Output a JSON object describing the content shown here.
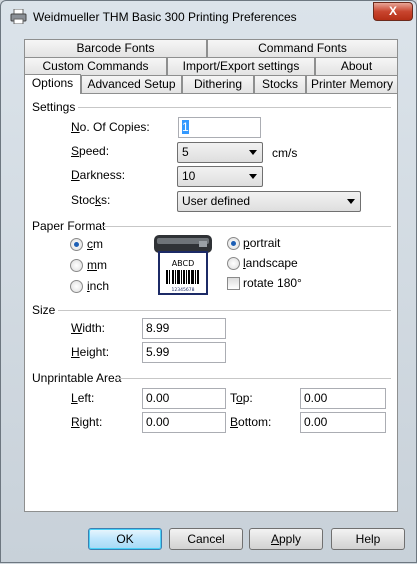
{
  "window": {
    "title": "Weidmueller THM Basic 300 Printing Preferences",
    "close_label": "X"
  },
  "tabs": {
    "row1": [
      "Barcode Fonts",
      "Command Fonts"
    ],
    "row2": [
      "Custom Commands",
      "Import/Export settings",
      "About"
    ],
    "row3": [
      "Options",
      "Advanced Setup",
      "Dithering",
      "Stocks",
      "Printer Memory"
    ],
    "active": "Options"
  },
  "settings": {
    "section": "Settings",
    "copies_label_u": "N",
    "copies_label_rest": "o. Of Copies:",
    "copies_value": "1",
    "speed_label_u": "S",
    "speed_label_rest": "peed:",
    "speed_value": "5",
    "speed_unit": "cm/s",
    "darkness_label_u": "D",
    "darkness_label_rest": "arkness:",
    "darkness_value": "10",
    "stocks_label_pre": "Stoc",
    "stocks_label_u": "k",
    "stocks_label_rest": "s:",
    "stocks_value": "User defined"
  },
  "paper_format": {
    "section": "Paper Format",
    "units": [
      {
        "u": "c",
        "rest": "m",
        "checked": true
      },
      {
        "u": "m",
        "rest": "m",
        "checked": false
      },
      {
        "u": "i",
        "rest": "nch",
        "checked": false
      }
    ],
    "orientation": [
      {
        "u": "p",
        "rest": "ortrait",
        "checked": true
      },
      {
        "u": "l",
        "rest": "andscape",
        "checked": false
      }
    ],
    "rotate_label": "rotate 180°",
    "rotate_checked": false,
    "label_preview_text": "ABCD",
    "label_preview_number": "12345678"
  },
  "size": {
    "section": "Size",
    "width_label_u": "W",
    "width_label_rest": "idth:",
    "width_value": "8.99",
    "height_label_u": "H",
    "height_label_rest": "eight:",
    "height_value": "5.99"
  },
  "unprintable": {
    "section": "Unprintable Area",
    "left_label_u": "L",
    "left_label_rest": "eft:",
    "left_value": "0.00",
    "top_label_pre": "T",
    "top_label_u": "o",
    "top_label_rest": "p:",
    "top_value": "0.00",
    "right_label_u": "R",
    "right_label_rest": "ight:",
    "right_value": "0.00",
    "bottom_label_u": "B",
    "bottom_label_rest": "ottom:",
    "bottom_value": "0.00"
  },
  "buttons": {
    "ok": "OK",
    "cancel": "Cancel",
    "apply_u": "A",
    "apply_rest": "pply",
    "help": "Help"
  }
}
